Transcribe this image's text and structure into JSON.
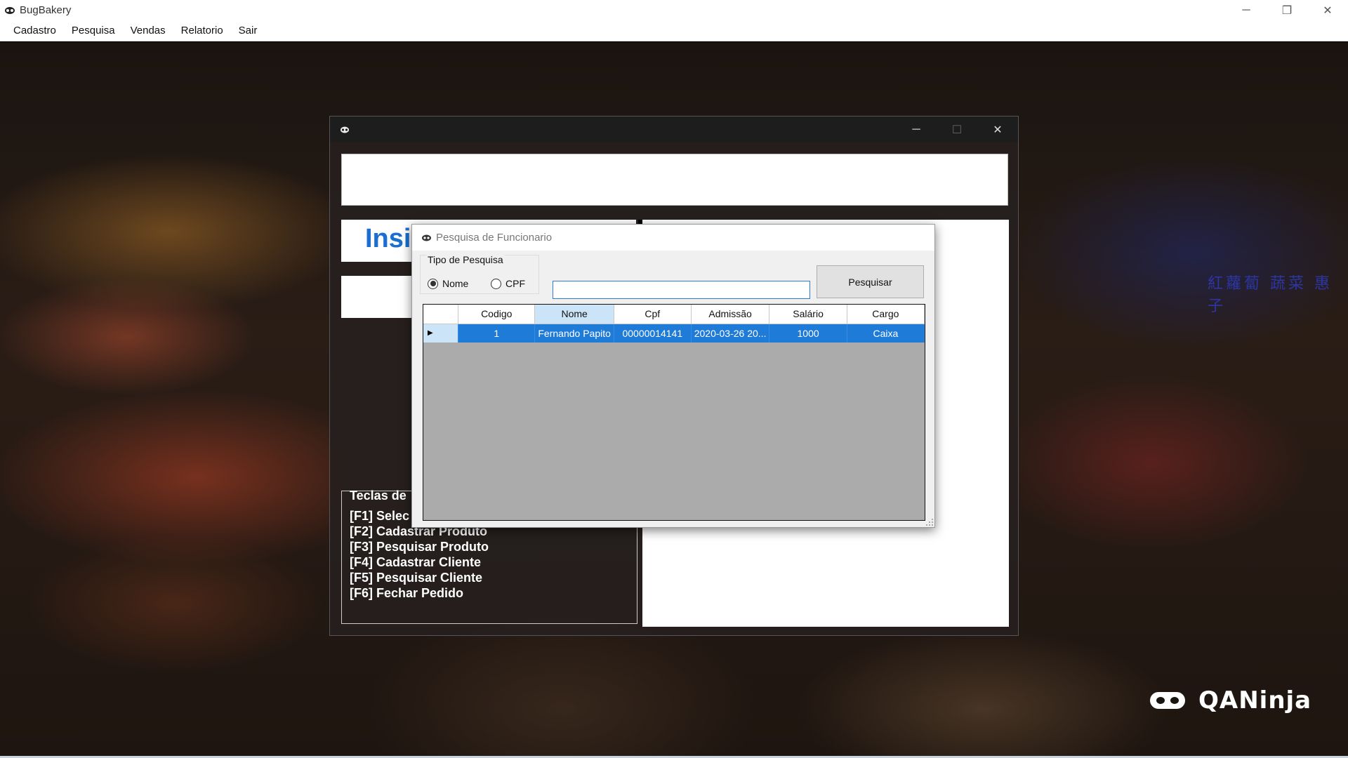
{
  "app": {
    "title": "BugBakery"
  },
  "window_controls": {
    "minimize": "─",
    "restore": "❐",
    "close": "✕"
  },
  "menu": [
    "Cadastro",
    "Pesquisa",
    "Vendas",
    "Relatorio",
    "Sair"
  ],
  "background": {
    "signage_text": "紅蘿蔔 蔬菜 惠子",
    "brand": "QANinja"
  },
  "child_window": {
    "heading_fragment": "Insi",
    "controls": {
      "minimize": "─",
      "maximize": "☐",
      "close": "✕"
    },
    "shortcuts_title": "Teclas de",
    "shortcuts": [
      "[F1] Selec",
      "[F2] Cadastrar Produto",
      "[F3] Pesquisar Produto",
      "[F4] Cadastrar Cliente",
      "[F5] Pesquisar Cliente",
      "[F6] Fechar Pedido"
    ]
  },
  "dialog": {
    "title": "Pesquisa de Funcionario",
    "search_type_label": "Tipo de Pesquisa",
    "radio_nome": "Nome",
    "radio_cpf": "CPF",
    "selected_type": "Nome",
    "search_value": "",
    "search_button": "Pesquisar",
    "grid": {
      "columns": [
        "Codigo",
        "Nome",
        "Cpf",
        "Admissão",
        "Salário",
        "Cargo"
      ],
      "sorted_column": "Nome",
      "rows": [
        [
          "1",
          "Fernando Papito",
          "00000014141",
          "2020-03-26 20...",
          "1000",
          "Caixa"
        ]
      ],
      "row_indicator": "▶"
    }
  },
  "colors": {
    "selection_blue": "#1f7bd8",
    "header_highlight": "#cce4f7",
    "heading_blue": "#1a6fd0"
  }
}
